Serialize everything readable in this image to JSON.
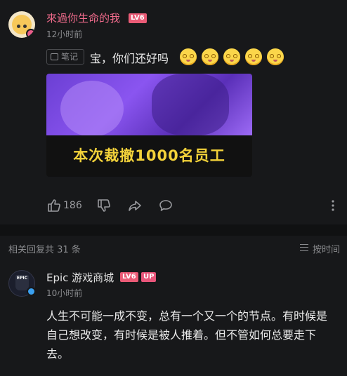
{
  "post": {
    "author": "來過你生命的我",
    "level": "LV6",
    "time": "12小时前",
    "note_tag": "笔记",
    "text": "宝，你们还好吗",
    "emojis": [
      "blushing-face",
      "blushing-face",
      "blushing-face",
      "blushing-face",
      "blushing-face"
    ],
    "image_caption": "本次裁撤1000名员工",
    "like_count": "186"
  },
  "replies": {
    "label": "相关回复共 31 条",
    "sort_label": "按时间"
  },
  "reply": {
    "author": "Epic 游戏商城",
    "level": "LV6",
    "badge": "UP",
    "avatar_text": "EPIC",
    "time": "10小时前",
    "text": "人生不可能一成不变，总有一个又一个的节点。有时候是自己想改变，有时候是被人推着。但不管如何总要走下去。"
  },
  "colors": {
    "background": "#17181a",
    "author_pink": "#f06b8c",
    "caption_yellow": "#f3d23a"
  }
}
